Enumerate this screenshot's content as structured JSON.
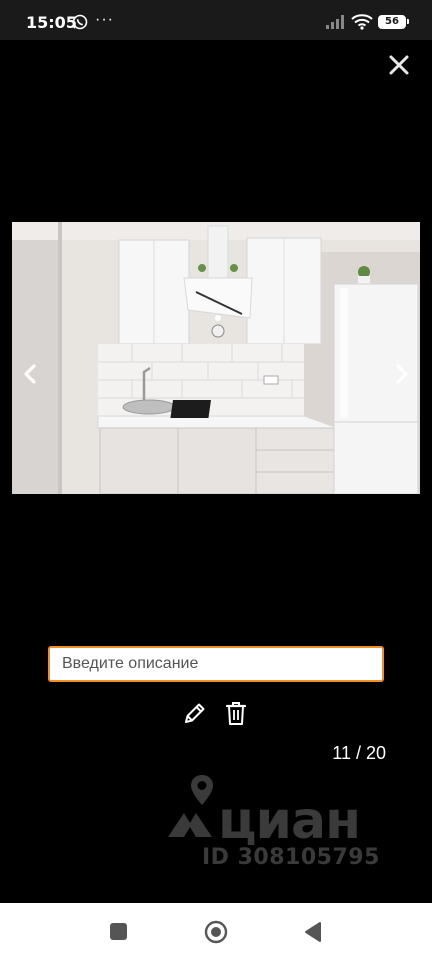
{
  "status_bar": {
    "time": "15:05",
    "dots": "···",
    "battery_level": "56",
    "icons": [
      "whatsapp-icon",
      "signal-icon",
      "wifi-icon",
      "battery-icon"
    ]
  },
  "viewer": {
    "close_icon": "close-icon",
    "prev_icon": "chevron-left-icon",
    "next_icon": "chevron-right-icon",
    "description_placeholder": "Введите описание",
    "description_value": "",
    "edit_icon": "pencil-icon",
    "delete_icon": "trash-icon",
    "counter": "11 / 20"
  },
  "watermark": {
    "brand": "циан",
    "id_text": "ID 308105795"
  },
  "navigation_bar": {
    "icons": [
      "recents-icon",
      "home-icon",
      "back-icon"
    ]
  },
  "colors": {
    "background": "#000000",
    "status_bar": "#1a1a1a",
    "input_border": "#f0902a",
    "navbar": "#ffffff"
  }
}
